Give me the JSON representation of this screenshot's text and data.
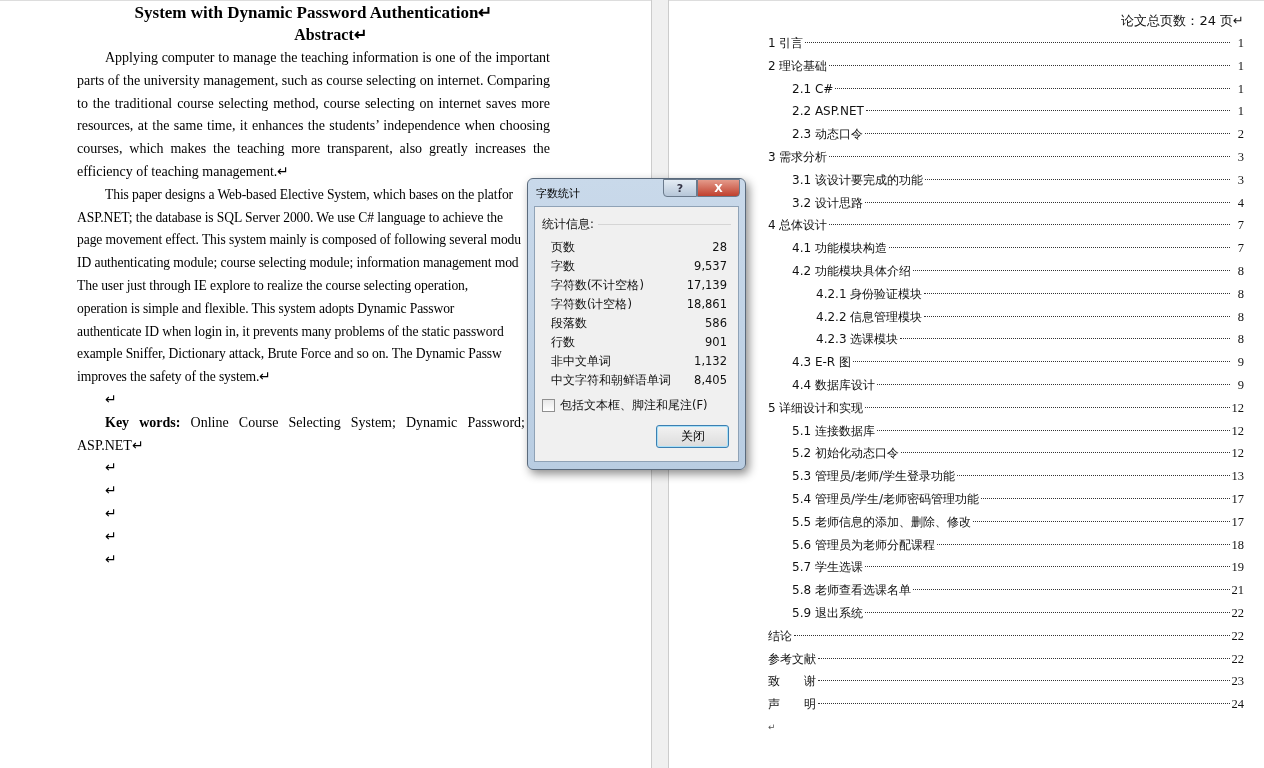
{
  "left_page": {
    "title": "System with Dynamic Password Authentication↵",
    "heading": "Abstract↵",
    "paragraphs": [
      {
        "lines": [
          "Applying computer to manage the teaching information is one of the important",
          "parts of the university management, such as course selecting on internet. Comparing",
          "to the traditional course selecting method, course selecting on internet saves more",
          "resources, at the same time, it enhances the students’ independence when choosing",
          "courses, which makes the teaching more transparent, also greatly increases the",
          "efficiency of teaching management.↵"
        ]
      },
      {
        "lines": [
          "This paper designs a Web-based Elective System, which bases on the platfor",
          "ASP.NET; the database is SQL Server 2000. We use C# language to achieve the",
          "page movement effect. This system mainly is composed of following several modu",
          "ID authenticating module; course selecting module; information management mod",
          "The user just through IE explore to realize the course selecting operation,",
          "operation is simple and flexible. This system adopts Dynamic Passwor",
          "authenticate ID when login in, it prevents many problems of the static password",
          "example Sniffer, Dictionary attack, Brute Force and so on. The Dynamic Passw",
          "improves the safety of the system.↵"
        ]
      },
      {
        "lines": [
          "↵"
        ]
      },
      {
        "lines": [
          "**Key words:** Online Course Selecting System; Dynamic Password;",
          "ASP.NET↵"
        ]
      },
      {
        "lines": [
          "↵"
        ]
      },
      {
        "lines": [
          "↵"
        ]
      },
      {
        "lines": [
          "↵"
        ]
      },
      {
        "lines": [
          "↵"
        ]
      },
      {
        "lines": [
          "↵"
        ]
      }
    ]
  },
  "right_page": {
    "page_count": "论文总页数：24 页↵",
    "toc": [
      {
        "label": "1 引言",
        "page": "1"
      },
      {
        "label": "2 理论基础",
        "page": "1",
        "children": [
          {
            "label": "2.1 C#",
            "page": "1"
          },
          {
            "label": "2.2 ASP.NET",
            "page": "1"
          },
          {
            "label": "2.3 动态口令",
            "page": "2"
          }
        ]
      },
      {
        "label": "3 需求分析",
        "page": "3",
        "children": [
          {
            "label": "3.1 该设计要完成的功能",
            "page": "3"
          },
          {
            "label": "3.2 设计思路",
            "page": "4"
          }
        ]
      },
      {
        "label": "4 总体设计",
        "page": "7",
        "children": [
          {
            "label": "4.1 功能模块构造",
            "page": "7"
          },
          {
            "label": "4.2 功能模块具体介绍",
            "page": "8",
            "children": [
              {
                "label": "4.2.1 身份验证模块",
                "page": "8"
              },
              {
                "label": "4.2.2 信息管理模块",
                "page": "8"
              },
              {
                "label": "4.2.3 选课模块",
                "page": "8"
              }
            ]
          },
          {
            "label": "4.3 E-R 图",
            "page": "9"
          },
          {
            "label": "4.4 数据库设计",
            "page": "9"
          }
        ]
      },
      {
        "label": "5 详细设计和实现",
        "page": "12",
        "children": [
          {
            "label": "5.1 连接数据库",
            "page": "12"
          },
          {
            "label": "5.2 初始化动态口令",
            "page": "12"
          },
          {
            "label": "5.3 管理员/老师/学生登录功能",
            "page": "13"
          },
          {
            "label": "5.4 管理员/学生/老师密码管理功能",
            "page": "17"
          },
          {
            "label": "5.5 老师信息的添加、删除、修改",
            "page": "17"
          },
          {
            "label": "5.6 管理员为老师分配课程",
            "page": "18"
          },
          {
            "label": "5.7 学生选课",
            "page": "19"
          },
          {
            "label": "5.8 老师查看选课名单",
            "page": "21"
          },
          {
            "label": "5.9 退出系统",
            "page": "22"
          }
        ]
      },
      {
        "label": "结论",
        "page": "22"
      },
      {
        "label": "参考文献",
        "page": "22"
      },
      {
        "label": "致　　谢",
        "page": "23"
      },
      {
        "label": "声　　明",
        "page": "24"
      }
    ],
    "end_mark": "↵"
  },
  "dialog": {
    "title": "字数统计",
    "help": "?",
    "close": "X",
    "group": "统计信息:",
    "stats": [
      {
        "label": "页数",
        "value": "28"
      },
      {
        "label": "字数",
        "value": "9,537"
      },
      {
        "label": "字符数(不计空格)",
        "value": "17,139"
      },
      {
        "label": "字符数(计空格)",
        "value": "18,861"
      },
      {
        "label": "段落数",
        "value": "586"
      },
      {
        "label": "行数",
        "value": "901"
      },
      {
        "label": "非中文单词",
        "value": "1,132"
      },
      {
        "label": "中文字符和朝鲜语单词",
        "value": "8,405"
      }
    ],
    "checkbox": {
      "label": "包括文本框、脚注和尾注(F)",
      "checked": false
    },
    "button": "关闭"
  }
}
